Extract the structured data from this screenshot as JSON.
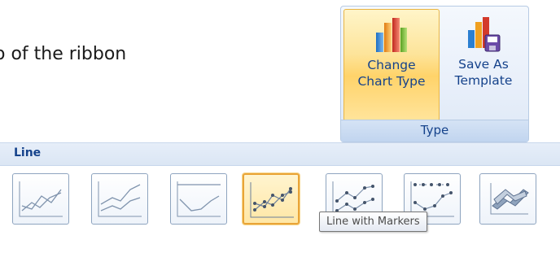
{
  "document": {
    "text": "o of the ribbon"
  },
  "ribbon_group": {
    "label": "Type",
    "buttons": [
      {
        "line1": "Change",
        "line2": "Chart Type",
        "icon": "bar-chart-icon",
        "state": "hover"
      },
      {
        "line1": "Save As",
        "line2": "Template",
        "icon": "save-chart-template-icon"
      }
    ]
  },
  "gallery": {
    "title": "Line",
    "items": [
      {
        "icon": "line-chart-icon"
      },
      {
        "icon": "stacked-line-chart-icon"
      },
      {
        "icon": "100-percent-stacked-line-chart-icon"
      },
      {
        "icon": "line-with-markers-chart-icon",
        "selected": true
      },
      {
        "icon": "stacked-line-with-markers-chart-icon"
      },
      {
        "icon": "100-percent-stacked-line-with-markers-chart-icon"
      },
      {
        "icon": "3d-line-chart-icon"
      }
    ]
  },
  "tooltip": {
    "text": "Line with Markers"
  },
  "colors": {
    "ribbon_text": "#15428b",
    "hover_border": "#e8b545",
    "tile_border": "#8ea4bf"
  }
}
